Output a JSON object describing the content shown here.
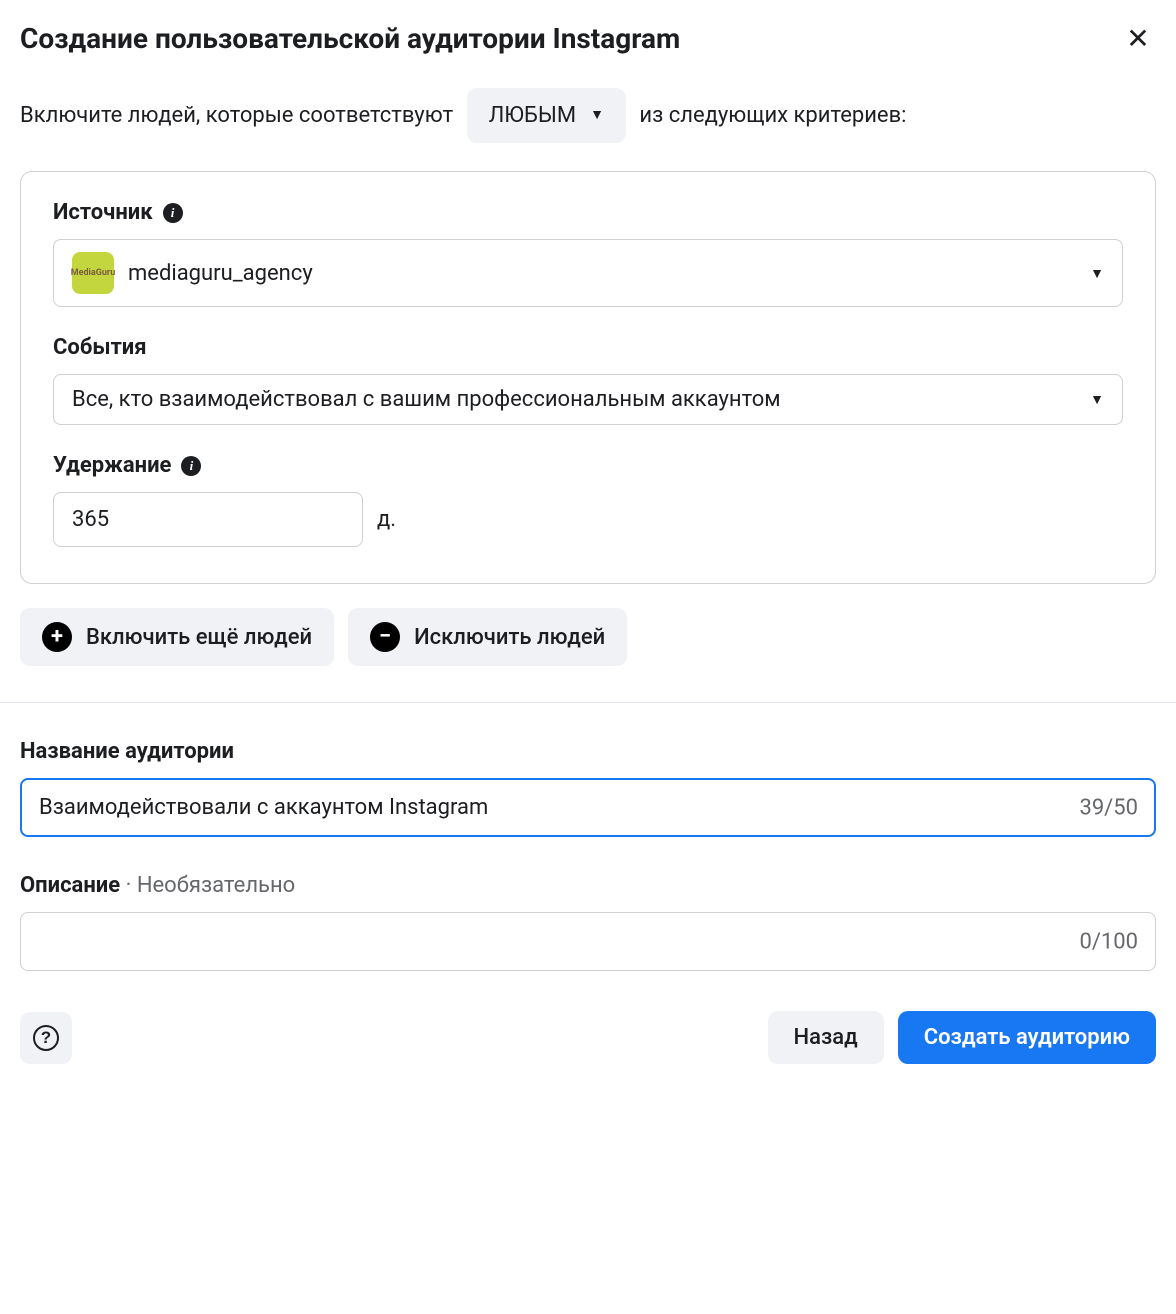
{
  "header": {
    "title": "Создание пользовательской аудитории Instagram"
  },
  "criteria": {
    "text_before": "Включите людей, которые соответствуют",
    "match_type": "ЛЮБЫМ",
    "text_after": "из следующих критериев:"
  },
  "source": {
    "label": "Источник",
    "value": "mediaguru_agency",
    "avatar_text": "MediaGuru"
  },
  "events": {
    "label": "События",
    "value": "Все, кто взаимодействовал с вашим профессиональным аккаунтом"
  },
  "retention": {
    "label": "Удержание",
    "value": "365",
    "unit": "д."
  },
  "actions": {
    "include_more": "Включить ещё людей",
    "exclude": "Исключить людей"
  },
  "audience_name": {
    "label": "Название аудитории",
    "value": "Взаимодействовали с аккаунтом Instagram",
    "counter": "39/50"
  },
  "description": {
    "label": "Описание",
    "optional": "Необязательно",
    "value": "",
    "counter": "0/100"
  },
  "footer": {
    "back": "Назад",
    "create": "Создать аудиторию"
  }
}
